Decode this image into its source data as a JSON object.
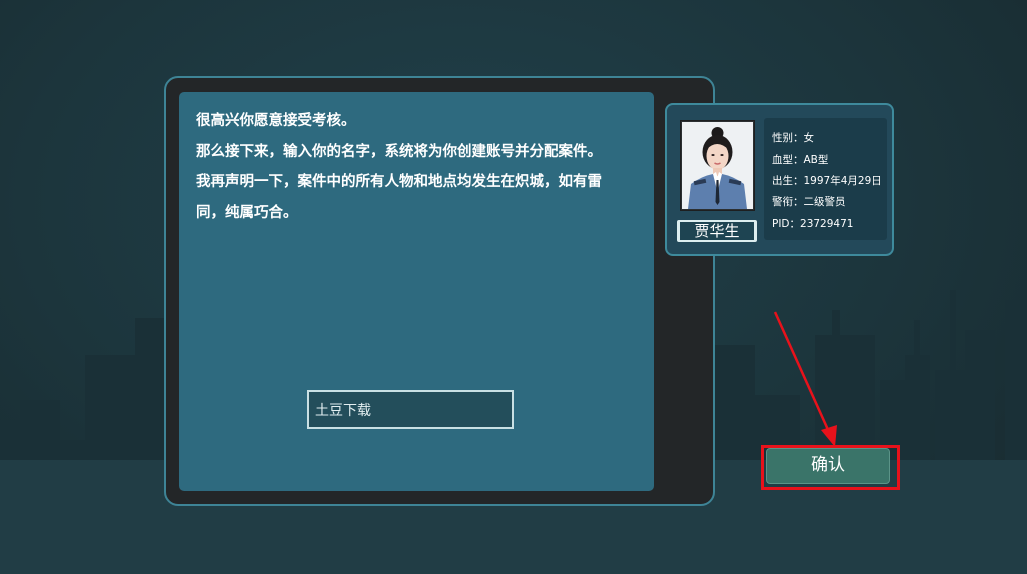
{
  "dialog": {
    "lines": [
      "很高兴你愿意接受考核。",
      "那么接下来，输入你的名字，系统将为你创建账号并分配案件。",
      "我再声明一下，案件中的所有人物和地点均发生在炽城，如有雷",
      "同，纯属巧合。"
    ]
  },
  "name_input": {
    "value": "土豆下载"
  },
  "id_card": {
    "name": "贾华生",
    "gender": "性别：女",
    "blood_type": "血型：AB型",
    "birth": "出生：1997年4月29日",
    "rank": "警衔：二级警员",
    "pid": "PID：23729471"
  },
  "confirm_button": {
    "label": "确认"
  },
  "colors": {
    "background": "#1c3339",
    "panel": "#2e6a7f",
    "frame_border": "#3e8496",
    "button": "#3a7469",
    "annotation": "#e8121b"
  },
  "icons": {
    "annotation_arrow": "red-arrow-icon",
    "photo": "police-officer-portrait"
  }
}
